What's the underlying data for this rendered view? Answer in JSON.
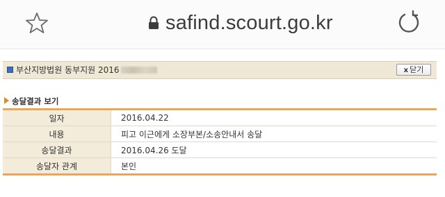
{
  "browser": {
    "url": "safind.scourt.go.kr",
    "icons": {
      "bookmark": "star-icon",
      "secure": "lock-icon",
      "reload": "reload-icon"
    }
  },
  "case": {
    "court_title": "부산지방법원 동부지원 2016",
    "close_label": "닫기",
    "close_mark": "x"
  },
  "section": {
    "title": "송달결과 보기"
  },
  "details": [
    {
      "label": "일자",
      "value": "2016.04.22"
    },
    {
      "label": "내용",
      "value": "피고 이근에게 소장부본/소송안내서 송달"
    },
    {
      "label": "송달결과",
      "value": "2016.04.26 도달"
    },
    {
      "label": "송달자 관계",
      "value": "본인"
    }
  ],
  "colors": {
    "accent_orange": "#e9a55a",
    "header_bg": "#f0e8d6",
    "label_bg": "#f3ecdb",
    "bullet_blue": "#3f6fb5"
  }
}
